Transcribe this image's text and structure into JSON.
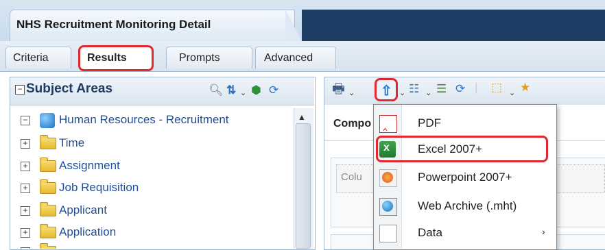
{
  "header": {
    "title": "NHS Recruitment Monitoring Detail"
  },
  "tabs": [
    {
      "label": "Criteria"
    },
    {
      "label": "Results"
    },
    {
      "label": "Prompts"
    },
    {
      "label": "Advanced"
    }
  ],
  "subject_areas": {
    "title": "Subject Areas",
    "root": "Human Resources - Recruitment",
    "folders": [
      {
        "label": "Time"
      },
      {
        "label": "Assignment"
      },
      {
        "label": "Job Requisition"
      },
      {
        "label": "Applicant"
      },
      {
        "label": "Application"
      }
    ]
  },
  "main": {
    "compound_label": "Compo",
    "column_hint": "Colu"
  },
  "export_menu": {
    "items": [
      {
        "label": "PDF",
        "icon": "pdf-icon"
      },
      {
        "label": "Excel 2007+",
        "icon": "excel-icon"
      },
      {
        "label": "Powerpoint 2007+",
        "icon": "powerpoint-icon"
      },
      {
        "label": "Web Archive (.mht)",
        "icon": "web-archive-icon"
      },
      {
        "label": "Data",
        "icon": "data-file-icon"
      }
    ]
  },
  "colors": {
    "highlight": "#e0282e",
    "nav_dark": "#1f3e66",
    "link_blue": "#1f4f9a"
  }
}
